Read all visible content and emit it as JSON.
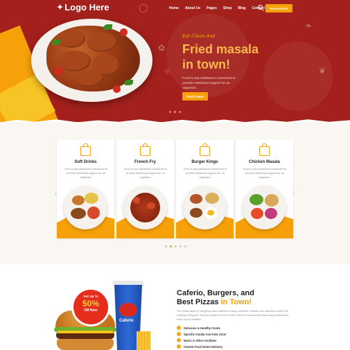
{
  "header": {
    "logo": "Logo Here",
    "nav": [
      "Home",
      "About Us",
      "Pages",
      "Shop",
      "Blog",
      "Contact Us"
    ],
    "cta": "Reservation"
  },
  "hero": {
    "tagline": "Eat Clean And",
    "title_line1": "Fried masala",
    "title_line2": "in town!",
    "text": "Food is any substance consumed to provide nutritional support for an organism.",
    "button": "Read it Here",
    "slider_total": 3,
    "slider_active": 2
  },
  "menu": {
    "items": [
      {
        "title": "Soft Drinks",
        "text": "Food is any substance consumed to provide nutritional support for an organism."
      },
      {
        "title": "French Fry",
        "text": "Food is any substance consumed to provide nutritional support for an organism."
      },
      {
        "title": "Burger Kingo",
        "text": "Food is any substance consumed to provide nutritional support for an organism."
      },
      {
        "title": "Chicken Masala",
        "text": "Food is any substance consumed to provide nutritional support for an organism."
      }
    ],
    "prev": "‹",
    "next": "›",
    "slider_total": 5,
    "slider_active": 2
  },
  "promo": {
    "badge_top": "Get Up To",
    "badge_value": "50%",
    "badge_bottom": "Off Now",
    "cup_label": "Caferio",
    "title_part1": "Caferio, Burgers, and",
    "title_part2": "Best Pizzas",
    "title_highlight": "in Town!",
    "text": "The restaurants in Hangzhou also catered to many northern Chinese who had fled south from Kaifeng during the Jurchen invasion of the 1120s, while it is also known that many restaurants were run by families.",
    "features": [
      "Delicious & Healthy Foods",
      "Specific Family And Kids Zone",
      "Music & Other Facilities",
      "Fastest Food Home Delivery"
    ]
  },
  "colors": {
    "hero_red": "#a3201c",
    "accent_orange": "#f6a10a",
    "promo_red": "#e52d1c"
  }
}
